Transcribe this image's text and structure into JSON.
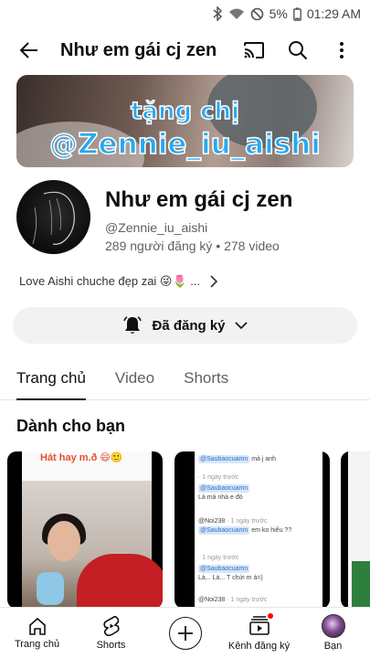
{
  "status_bar": {
    "battery_percent": "5%",
    "time": "01:29 AM",
    "icons": [
      "bluetooth-icon",
      "wifi-icon",
      "dnd-icon",
      "battery-icon"
    ]
  },
  "app_bar": {
    "title": "Như em gái cj zen",
    "icons": [
      "back-arrow-icon",
      "cast-icon",
      "search-icon",
      "more-vert-icon"
    ]
  },
  "banner": {
    "line1": "tặng chị",
    "line2": "@Zennie_iu_aishi",
    "text_color": "#29a7f0"
  },
  "channel": {
    "name": "Như em gái cj zen",
    "handle": "@Zennie_iu_aishi",
    "subscribers": "289 người đăng ký",
    "videos": "278 video",
    "separator": "•",
    "description": "Love Aishi chuche đẹp zai 😜🌷 ..."
  },
  "subscribe": {
    "label": "Đã đăng ký"
  },
  "tabs": [
    {
      "label": "Trang chủ",
      "active": true
    },
    {
      "label": "Video",
      "active": false
    },
    {
      "label": "Shorts",
      "active": false
    }
  ],
  "section": {
    "title": "Dành cho bạn"
  },
  "shorts": {
    "short1_caption": "Hát hay m.ð 😄🙂",
    "short2_comments": [
      {
        "tag": "@Saubaocuamn",
        "text": "mà j anh",
        "meta": ""
      },
      {
        "tag": "",
        "text": "",
        "meta": "· 1 ngày trước"
      },
      {
        "tag": "@Saubaocuamn",
        "text": "Là má nhà e đó",
        "meta": ""
      },
      {
        "tag": "",
        "text": "@Noi238",
        "meta": "· 1 ngày trước"
      },
      {
        "tag": "@Saubaocuamn",
        "text": "em ko hiểu ??",
        "meta": ""
      },
      {
        "tag": "",
        "text": "",
        "meta": "· 1 ngày trước"
      },
      {
        "tag": "@Saubaocuamn",
        "text": "Là... Là... T chửi m á=)",
        "meta": ""
      },
      {
        "tag": "",
        "text": "@Noi238",
        "meta": "· 1 ngày trước"
      }
    ]
  },
  "bottom_nav": [
    {
      "label": "Trang chủ",
      "icon": "home-icon"
    },
    {
      "label": "Shorts",
      "icon": "shorts-icon"
    },
    {
      "label": "",
      "icon": "create-icon"
    },
    {
      "label": "Kênh đăng ký",
      "icon": "subscriptions-icon"
    },
    {
      "label": "Bạn",
      "icon": "you-avatar"
    }
  ]
}
